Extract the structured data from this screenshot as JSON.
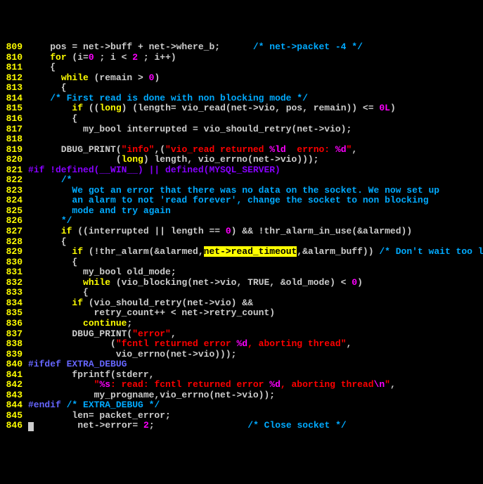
{
  "lines": [
    {
      "num": "809",
      "segments": [
        {
          "cls": "text",
          "txt": "    pos = net->buff + net->where_b;      "
        },
        {
          "cls": "comment",
          "txt": "/* net->packet -4 */"
        }
      ]
    },
    {
      "num": "810",
      "segments": [
        {
          "cls": "text",
          "txt": "    "
        },
        {
          "cls": "keyword",
          "txt": "for"
        },
        {
          "cls": "text",
          "txt": " (i="
        },
        {
          "cls": "number",
          "txt": "0"
        },
        {
          "cls": "text",
          "txt": " ; i < "
        },
        {
          "cls": "number",
          "txt": "2"
        },
        {
          "cls": "text",
          "txt": " ; i++)"
        }
      ]
    },
    {
      "num": "811",
      "segments": [
        {
          "cls": "text",
          "txt": "    {"
        }
      ]
    },
    {
      "num": "812",
      "segments": [
        {
          "cls": "text",
          "txt": "      "
        },
        {
          "cls": "keyword",
          "txt": "while"
        },
        {
          "cls": "text",
          "txt": " (remain > "
        },
        {
          "cls": "number",
          "txt": "0"
        },
        {
          "cls": "text",
          "txt": ")"
        }
      ]
    },
    {
      "num": "813",
      "segments": [
        {
          "cls": "text",
          "txt": "      {"
        }
      ]
    },
    {
      "num": "814",
      "segments": [
        {
          "cls": "text",
          "txt": "    "
        },
        {
          "cls": "comment",
          "txt": "/* First read is done with non blocking mode */"
        }
      ]
    },
    {
      "num": "815",
      "segments": [
        {
          "cls": "text",
          "txt": "        "
        },
        {
          "cls": "keyword",
          "txt": "if"
        },
        {
          "cls": "text",
          "txt": " (("
        },
        {
          "cls": "keyword",
          "txt": "long"
        },
        {
          "cls": "text",
          "txt": ") (length= vio_read(net->vio, pos, remain)) <= "
        },
        {
          "cls": "number",
          "txt": "0L"
        },
        {
          "cls": "text",
          "txt": ")"
        }
      ]
    },
    {
      "num": "816",
      "segments": [
        {
          "cls": "text",
          "txt": "        {"
        }
      ]
    },
    {
      "num": "817",
      "segments": [
        {
          "cls": "text",
          "txt": "          my_bool interrupted = vio_should_retry(net->vio);"
        }
      ]
    },
    {
      "num": "818",
      "segments": [
        {
          "cls": "text",
          "txt": ""
        }
      ]
    },
    {
      "num": "819",
      "segments": [
        {
          "cls": "text",
          "txt": "      DBUG_PRINT("
        },
        {
          "cls": "string",
          "txt": "\"info\""
        },
        {
          "cls": "text",
          "txt": ",("
        },
        {
          "cls": "string",
          "txt": "\"vio_read returned "
        },
        {
          "cls": "escape",
          "txt": "%ld"
        },
        {
          "cls": "string",
          "txt": "  errno: "
        },
        {
          "cls": "escape",
          "txt": "%d"
        },
        {
          "cls": "string",
          "txt": "\""
        },
        {
          "cls": "text",
          "txt": ","
        }
      ]
    },
    {
      "num": "820",
      "segments": [
        {
          "cls": "text",
          "txt": "                ("
        },
        {
          "cls": "keyword",
          "txt": "long"
        },
        {
          "cls": "text",
          "txt": ") length, vio_errno(net->vio)));"
        }
      ]
    },
    {
      "num": "821",
      "segments": [
        {
          "cls": "preprocessor",
          "txt": "#if !defined(__WIN__) || defined(MYSQL_SERVER)"
        }
      ]
    },
    {
      "num": "822",
      "segments": [
        {
          "cls": "text",
          "txt": "      "
        },
        {
          "cls": "comment",
          "txt": "/*"
        }
      ]
    },
    {
      "num": "823",
      "segments": [
        {
          "cls": "comment",
          "txt": "        We got an error that there was no data on the socket. We now set up"
        }
      ]
    },
    {
      "num": "824",
      "segments": [
        {
          "cls": "comment",
          "txt": "        an alarm to not 'read forever', change the socket to non blocking"
        }
      ]
    },
    {
      "num": "825",
      "segments": [
        {
          "cls": "comment",
          "txt": "        mode and try again"
        }
      ]
    },
    {
      "num": "826",
      "segments": [
        {
          "cls": "text",
          "txt": "      "
        },
        {
          "cls": "comment",
          "txt": "*/"
        }
      ]
    },
    {
      "num": "827",
      "segments": [
        {
          "cls": "text",
          "txt": "      "
        },
        {
          "cls": "keyword",
          "txt": "if"
        },
        {
          "cls": "text",
          "txt": " ((interrupted || length == "
        },
        {
          "cls": "number",
          "txt": "0"
        },
        {
          "cls": "text",
          "txt": ") && !thr_alarm_in_use(&alarmed))"
        }
      ]
    },
    {
      "num": "828",
      "segments": [
        {
          "cls": "text",
          "txt": "      {"
        }
      ]
    },
    {
      "num": "829",
      "segments": [
        {
          "cls": "text",
          "txt": "        "
        },
        {
          "cls": "keyword",
          "txt": "if"
        },
        {
          "cls": "text",
          "txt": " (!thr_alarm(&alarmed,"
        },
        {
          "cls": "highlight",
          "txt": "net->read_timeout"
        },
        {
          "cls": "text",
          "txt": ",&alarm_buff)) "
        },
        {
          "cls": "comment",
          "txt": "/* Don't wait too long */"
        }
      ]
    },
    {
      "num": "830",
      "segments": [
        {
          "cls": "text",
          "txt": "        {"
        }
      ]
    },
    {
      "num": "831",
      "segments": [
        {
          "cls": "text",
          "txt": "          my_bool old_mode;"
        }
      ]
    },
    {
      "num": "832",
      "segments": [
        {
          "cls": "text",
          "txt": "          "
        },
        {
          "cls": "keyword",
          "txt": "while"
        },
        {
          "cls": "text",
          "txt": " (vio_blocking(net->vio, TRUE, &old_mode) < "
        },
        {
          "cls": "number",
          "txt": "0"
        },
        {
          "cls": "text",
          "txt": ")"
        }
      ]
    },
    {
      "num": "833",
      "segments": [
        {
          "cls": "text",
          "txt": "          {"
        }
      ]
    },
    {
      "num": "834",
      "segments": [
        {
          "cls": "text",
          "txt": "        "
        },
        {
          "cls": "keyword",
          "txt": "if"
        },
        {
          "cls": "text",
          "txt": " (vio_should_retry(net->vio) &&"
        }
      ]
    },
    {
      "num": "835",
      "segments": [
        {
          "cls": "text",
          "txt": "            retry_count++ < net->retry_count)"
        }
      ]
    },
    {
      "num": "836",
      "segments": [
        {
          "cls": "text",
          "txt": "          "
        },
        {
          "cls": "keyword",
          "txt": "continue"
        },
        {
          "cls": "text",
          "txt": ";"
        }
      ]
    },
    {
      "num": "837",
      "segments": [
        {
          "cls": "text",
          "txt": "        DBUG_PRINT("
        },
        {
          "cls": "string",
          "txt": "\"error\""
        },
        {
          "cls": "text",
          "txt": ","
        }
      ]
    },
    {
      "num": "838",
      "segments": [
        {
          "cls": "text",
          "txt": "               ("
        },
        {
          "cls": "string",
          "txt": "\"fcntl returned error "
        },
        {
          "cls": "escape",
          "txt": "%d"
        },
        {
          "cls": "string",
          "txt": ", aborting thread\""
        },
        {
          "cls": "text",
          "txt": ","
        }
      ]
    },
    {
      "num": "839",
      "segments": [
        {
          "cls": "text",
          "txt": "                vio_errno(net->vio)));"
        }
      ]
    },
    {
      "num": "840",
      "segments": [
        {
          "cls": "preprocessor2",
          "txt": "#ifdef EXTRA_DEBUG"
        }
      ]
    },
    {
      "num": "841",
      "segments": [
        {
          "cls": "text",
          "txt": "        fprintf(stderr,"
        }
      ]
    },
    {
      "num": "842",
      "segments": [
        {
          "cls": "text",
          "txt": "            "
        },
        {
          "cls": "string",
          "txt": "\""
        },
        {
          "cls": "escape",
          "txt": "%s"
        },
        {
          "cls": "string",
          "txt": ": read: fcntl returned error "
        },
        {
          "cls": "escape",
          "txt": "%d"
        },
        {
          "cls": "string",
          "txt": ", aborting thread"
        },
        {
          "cls": "escape",
          "txt": "\\n"
        },
        {
          "cls": "string",
          "txt": "\""
        },
        {
          "cls": "text",
          "txt": ","
        }
      ]
    },
    {
      "num": "843",
      "segments": [
        {
          "cls": "text",
          "txt": "            my_progname,vio_errno(net->vio));"
        }
      ]
    },
    {
      "num": "844",
      "segments": [
        {
          "cls": "preprocessor2",
          "txt": "#endif"
        },
        {
          "cls": "text",
          "txt": " "
        },
        {
          "cls": "comment",
          "txt": "/* EXTRA_DEBUG */"
        }
      ]
    },
    {
      "num": "845",
      "segments": [
        {
          "cls": "text",
          "txt": "        len= packet_error;"
        }
      ]
    },
    {
      "num": "846",
      "segments": [
        {
          "cls": "text",
          "cursor": true,
          "txt": "        net->error= "
        },
        {
          "cls": "number",
          "txt": "2"
        },
        {
          "cls": "text",
          "txt": ";                 "
        },
        {
          "cls": "comment",
          "txt": "/* Close socket */"
        }
      ]
    }
  ]
}
